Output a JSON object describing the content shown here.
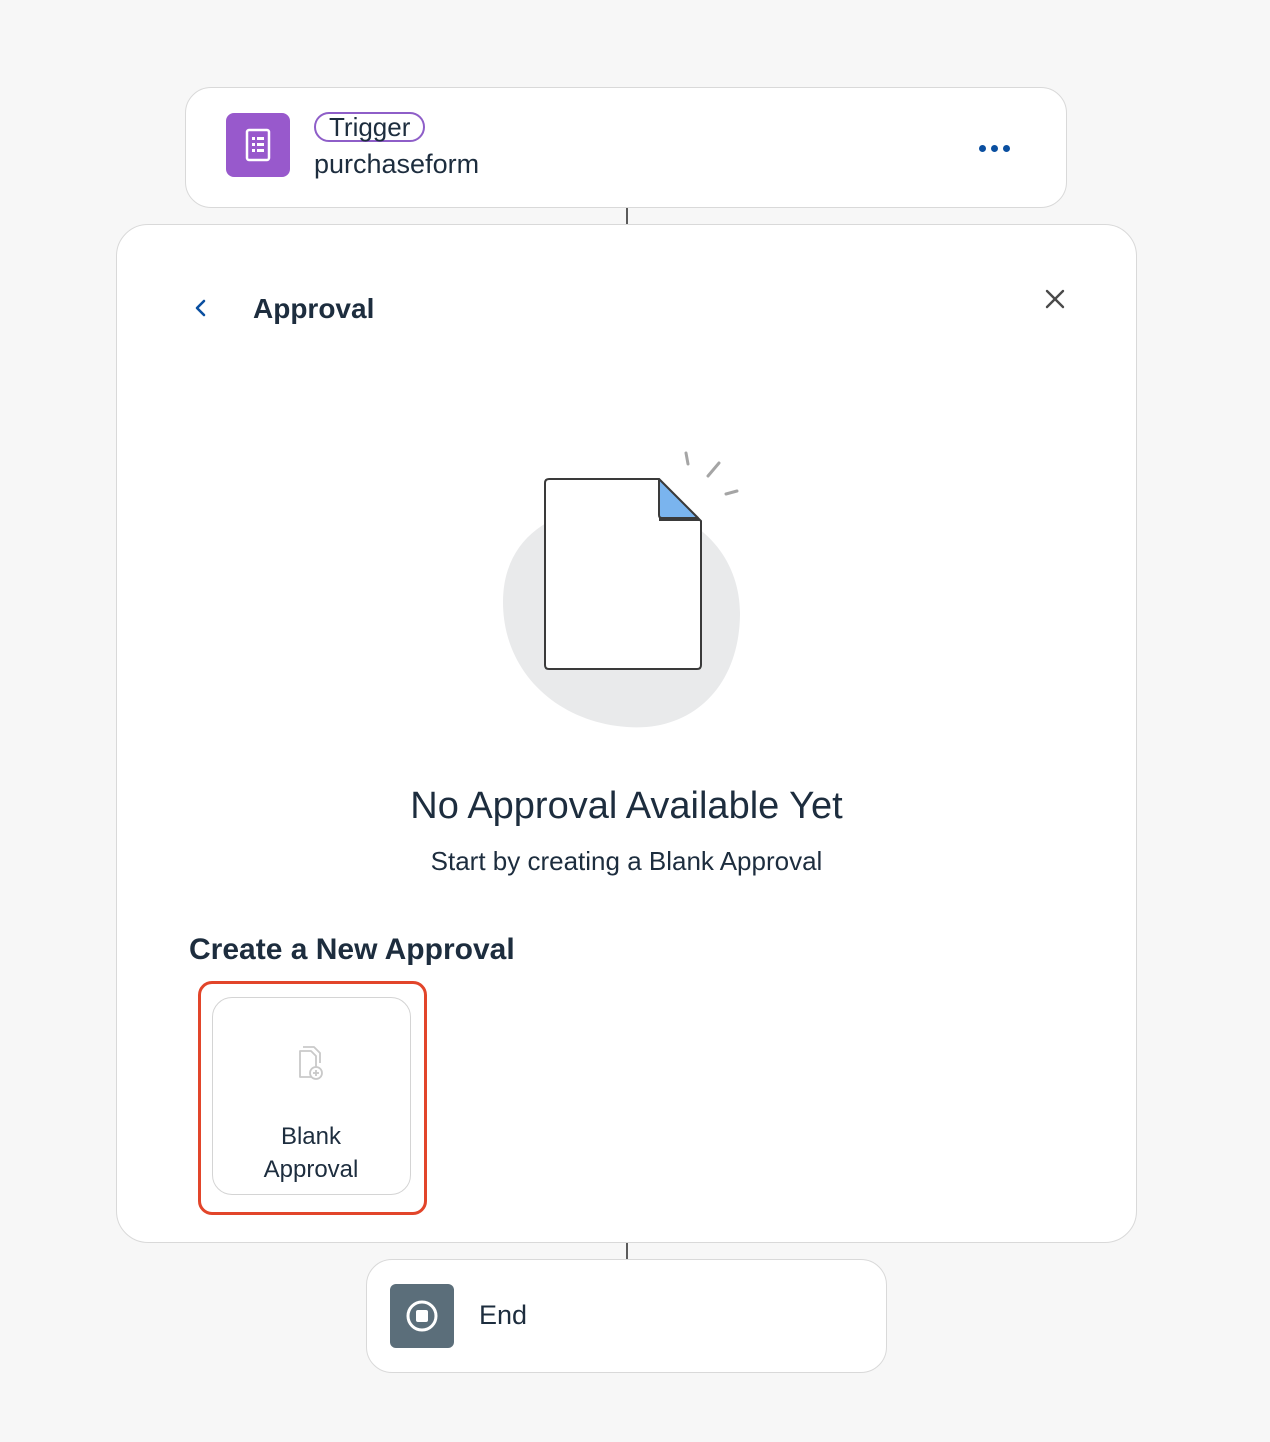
{
  "trigger": {
    "badge": "Trigger",
    "name": "purchaseform",
    "icon": "form-icon",
    "more_icon": "more-horizontal-icon",
    "accent": "#9859cc"
  },
  "approval": {
    "title": "Approval",
    "back_icon": "chevron-left-icon",
    "close_icon": "close-icon",
    "empty_state": {
      "title": "No Approval Available Yet",
      "subtitle": "Start by creating a Blank Approval",
      "illustration": "empty-document-illustration"
    },
    "create_heading": "Create a New Approval",
    "templates": [
      {
        "label_line1": "Blank",
        "label_line2": "Approval",
        "icon": "add-document-icon",
        "highlighted": true
      }
    ],
    "highlight_color": "#e2452a"
  },
  "end": {
    "label": "End",
    "icon": "stop-icon",
    "accent": "#5b6e7a"
  }
}
